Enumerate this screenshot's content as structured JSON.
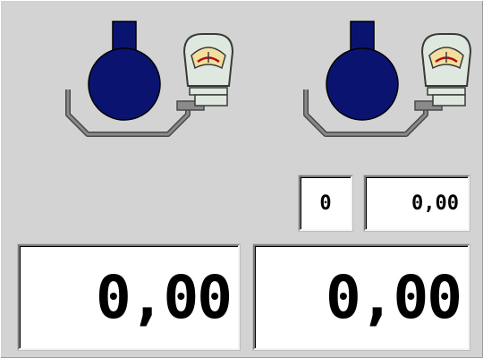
{
  "scales": {
    "left": {
      "icon": "beaker-on-scale-icon",
      "gauge_icon": "weighing-gauge-icon"
    },
    "right": {
      "icon": "beaker-on-scale-icon",
      "gauge_icon": "weighing-gauge-icon"
    }
  },
  "readouts": {
    "count": "0",
    "unit_weight": "0,00",
    "weight_left": "0,00",
    "weight_right": "0,00"
  },
  "colors": {
    "panel": "#d3d3d3",
    "beaker": "#0a1470",
    "gauge_face": "#f2dfa0",
    "gauge_body": "#dfe8df",
    "tray": "#808080"
  }
}
